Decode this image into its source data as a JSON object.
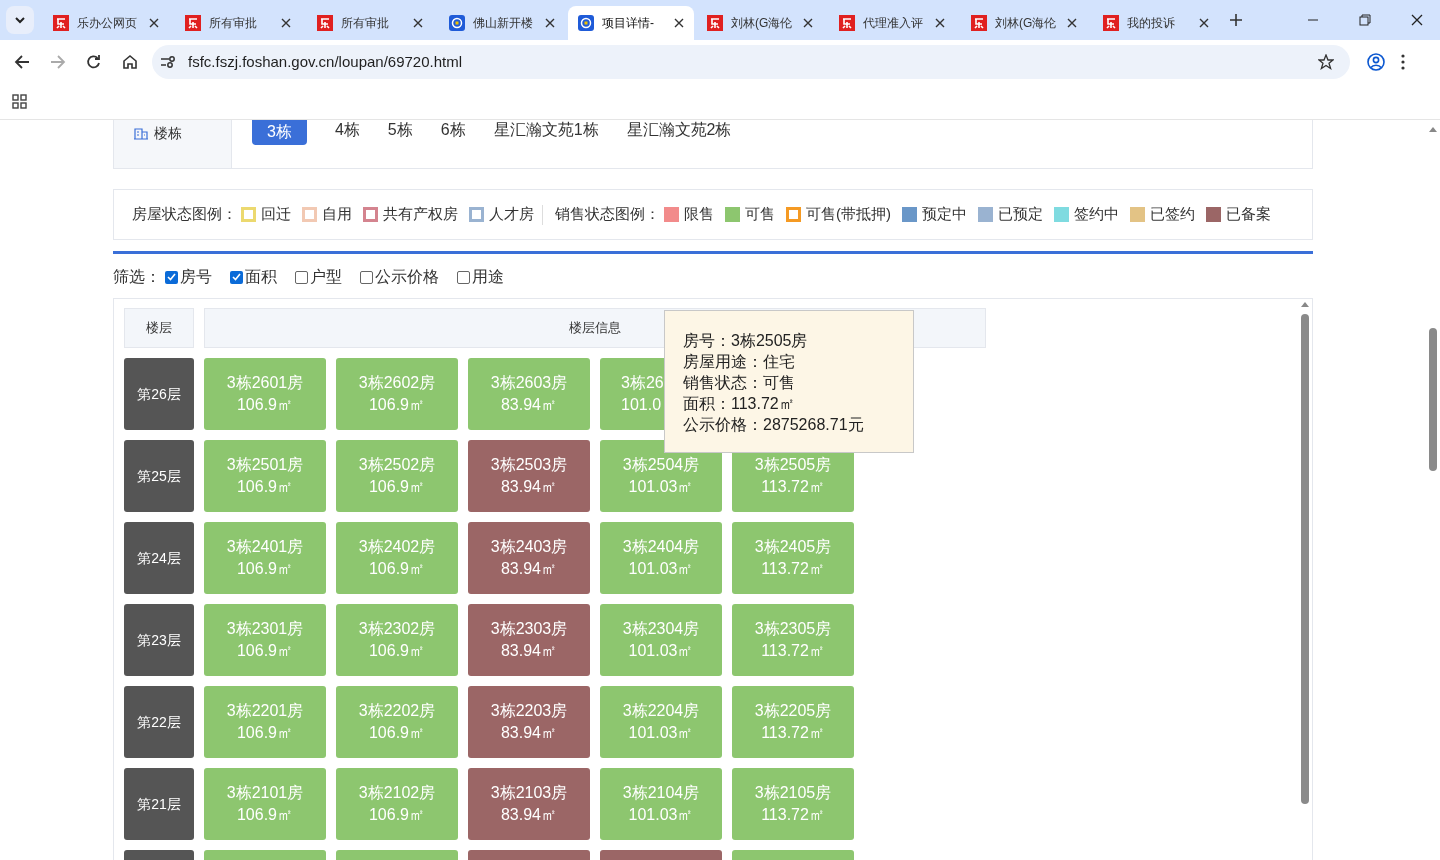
{
  "browser": {
    "tabs": [
      {
        "title": "乐办公网页",
        "kind": "le",
        "selected": false
      },
      {
        "title": "所有审批",
        "kind": "le",
        "selected": false
      },
      {
        "title": "所有审批",
        "kind": "le",
        "selected": false
      },
      {
        "title": "佛山新开楼",
        "kind": "badge",
        "selected": false
      },
      {
        "title": "项目详情-",
        "kind": "badge",
        "selected": true
      },
      {
        "title": "刘林(G海伦",
        "kind": "le",
        "selected": false
      },
      {
        "title": "代理准入评",
        "kind": "le",
        "selected": false
      },
      {
        "title": "刘林(G海伦",
        "kind": "le",
        "selected": false
      },
      {
        "title": "我的投诉",
        "kind": "le",
        "selected": false
      }
    ],
    "address": "fsfc.fszj.foshan.gov.cn/loupan/69720.html"
  },
  "buildings": {
    "label": "楼栋",
    "items": [
      {
        "label": "3栋",
        "selected": true
      },
      {
        "label": "4栋",
        "selected": false
      },
      {
        "label": "5栋",
        "selected": false
      },
      {
        "label": "6栋",
        "selected": false
      },
      {
        "label": "星汇瀚文苑1栋",
        "selected": false
      },
      {
        "label": "星汇瀚文苑2栋",
        "selected": false
      }
    ]
  },
  "legend": {
    "house_status": {
      "label": "房屋状态图例：",
      "items": [
        {
          "label": "回迁",
          "color": "#ecd96f",
          "kind": "outline"
        },
        {
          "label": "自用",
          "color": "#f2c9b3",
          "kind": "outline"
        },
        {
          "label": "共有产权房",
          "color": "#d4848f",
          "kind": "outline"
        },
        {
          "label": "人才房",
          "color": "#9ab3d1",
          "kind": "outline"
        }
      ]
    },
    "sale_status": {
      "label": "销售状态图例：",
      "items": [
        {
          "label": "限售",
          "color": "#f28b8b",
          "kind": "solid"
        },
        {
          "label": "可售",
          "color": "#8dc66f",
          "kind": "solid"
        },
        {
          "label": "可售(带抵押)",
          "color": "#f59a23",
          "kind": "outline"
        },
        {
          "label": "预定中",
          "color": "#6a97c8",
          "kind": "solid"
        },
        {
          "label": "已预定",
          "color": "#9ab3d1",
          "kind": "solid"
        },
        {
          "label": "签约中",
          "color": "#7fdbe0",
          "kind": "solid"
        },
        {
          "label": "已签约",
          "color": "#e3c385",
          "kind": "solid"
        },
        {
          "label": "已备案",
          "color": "#9b6666",
          "kind": "solid"
        }
      ]
    }
  },
  "filter": {
    "label": "筛选：",
    "options": [
      {
        "label": "房号",
        "checked": true
      },
      {
        "label": "面积",
        "checked": true
      },
      {
        "label": "户型",
        "checked": false
      },
      {
        "label": "公示价格",
        "checked": false
      },
      {
        "label": "用途",
        "checked": false
      }
    ]
  },
  "table": {
    "headers": [
      "楼层",
      "楼层信息"
    ],
    "floors": [
      {
        "label": "第26层",
        "units": [
          {
            "room": "3栋2601房",
            "area": "106.9㎡",
            "color": "#8dc66f",
            "clipped": false
          },
          {
            "room": "3栋2602房",
            "area": "106.9㎡",
            "color": "#8dc66f",
            "clipped": false
          },
          {
            "room": "3栋2603房",
            "area": "83.94㎡",
            "color": "#8dc66f",
            "clipped": false
          },
          {
            "room": "3栋26",
            "area": "101.0",
            "color": "#8dc66f",
            "clipped": true
          }
        ]
      },
      {
        "label": "第25层",
        "units": [
          {
            "room": "3栋2501房",
            "area": "106.9㎡",
            "color": "#8dc66f",
            "clipped": false
          },
          {
            "room": "3栋2502房",
            "area": "106.9㎡",
            "color": "#8dc66f",
            "clipped": false
          },
          {
            "room": "3栋2503房",
            "area": "83.94㎡",
            "color": "#9b6666",
            "clipped": false
          },
          {
            "room": "3栋2504房",
            "area": "101.03㎡",
            "color": "#8dc66f",
            "clipped": false
          },
          {
            "room": "3栋2505房",
            "area": "113.72㎡",
            "color": "#8dc66f",
            "clipped": false
          }
        ]
      },
      {
        "label": "第24层",
        "units": [
          {
            "room": "3栋2401房",
            "area": "106.9㎡",
            "color": "#8dc66f",
            "clipped": false
          },
          {
            "room": "3栋2402房",
            "area": "106.9㎡",
            "color": "#8dc66f",
            "clipped": false
          },
          {
            "room": "3栋2403房",
            "area": "83.94㎡",
            "color": "#9b6666",
            "clipped": false
          },
          {
            "room": "3栋2404房",
            "area": "101.03㎡",
            "color": "#8dc66f",
            "clipped": false
          },
          {
            "room": "3栋2405房",
            "area": "113.72㎡",
            "color": "#8dc66f",
            "clipped": false
          }
        ]
      },
      {
        "label": "第23层",
        "units": [
          {
            "room": "3栋2301房",
            "area": "106.9㎡",
            "color": "#8dc66f",
            "clipped": false
          },
          {
            "room": "3栋2302房",
            "area": "106.9㎡",
            "color": "#8dc66f",
            "clipped": false
          },
          {
            "room": "3栋2303房",
            "area": "83.94㎡",
            "color": "#9b6666",
            "clipped": false
          },
          {
            "room": "3栋2304房",
            "area": "101.03㎡",
            "color": "#8dc66f",
            "clipped": false
          },
          {
            "room": "3栋2305房",
            "area": "113.72㎡",
            "color": "#8dc66f",
            "clipped": false
          }
        ]
      },
      {
        "label": "第22层",
        "units": [
          {
            "room": "3栋2201房",
            "area": "106.9㎡",
            "color": "#8dc66f",
            "clipped": false
          },
          {
            "room": "3栋2202房",
            "area": "106.9㎡",
            "color": "#8dc66f",
            "clipped": false
          },
          {
            "room": "3栋2203房",
            "area": "83.94㎡",
            "color": "#9b6666",
            "clipped": false
          },
          {
            "room": "3栋2204房",
            "area": "101.03㎡",
            "color": "#8dc66f",
            "clipped": false
          },
          {
            "room": "3栋2205房",
            "area": "113.72㎡",
            "color": "#8dc66f",
            "clipped": false
          }
        ]
      },
      {
        "label": "第21层",
        "units": [
          {
            "room": "3栋2101房",
            "area": "106.9㎡",
            "color": "#8dc66f",
            "clipped": false
          },
          {
            "room": "3栋2102房",
            "area": "106.9㎡",
            "color": "#8dc66f",
            "clipped": false
          },
          {
            "room": "3栋2103房",
            "area": "83.94㎡",
            "color": "#9b6666",
            "clipped": false
          },
          {
            "room": "3栋2104房",
            "area": "101.03㎡",
            "color": "#8dc66f",
            "clipped": false
          },
          {
            "room": "3栋2105房",
            "area": "113.72㎡",
            "color": "#8dc66f",
            "clipped": false
          }
        ]
      }
    ],
    "partial_floor": {
      "units": [
        {
          "color": "#8dc66f"
        },
        {
          "color": "#8dc66f"
        },
        {
          "color": "#9b6666"
        },
        {
          "color": "#9b6666"
        },
        {
          "color": "#8dc66f"
        }
      ]
    }
  },
  "tooltip": {
    "lines": [
      "房号：3栋2505房",
      "房屋用途：住宅",
      "销售状态：可售",
      "面积：113.72㎡",
      "公示价格：2875268.71元"
    ]
  }
}
